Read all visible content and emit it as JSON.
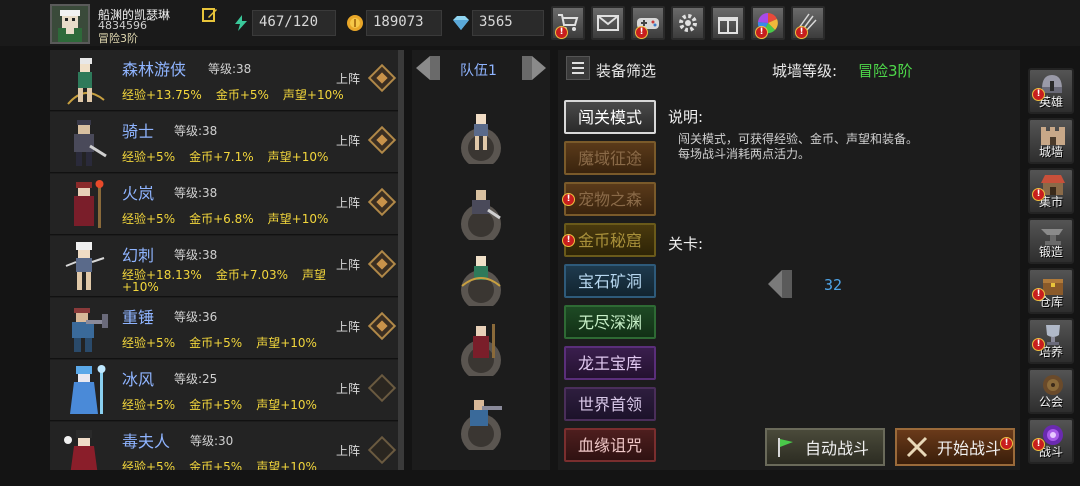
{
  "player": {
    "name": "船渊的凯瑟琳",
    "id": "4834596",
    "rank": "冒险3阶"
  },
  "resources": [
    {
      "icon": "energy-icon",
      "value": "467/120"
    },
    {
      "icon": "gold-coin-icon",
      "value": "189073"
    },
    {
      "icon": "diamond-icon",
      "value": "3565"
    }
  ],
  "toolbar": [
    {
      "icon": "shop-cart-icon",
      "alert": true
    },
    {
      "icon": "mail-icon",
      "alert": false
    },
    {
      "icon": "gamepad-icon",
      "alert": true
    },
    {
      "icon": "settings-gear-icon",
      "alert": false
    },
    {
      "icon": "gift-icon",
      "alert": false
    },
    {
      "icon": "color-wheel-icon",
      "alert": true
    },
    {
      "icon": "fireworks-icon",
      "alert": true
    }
  ],
  "heroes": [
    {
      "name": "森林游侠",
      "level": "等级:38",
      "stats": [
        "经验+13.75%",
        "金币+5%",
        "声望+10%"
      ],
      "action": "上阵",
      "deployed": true
    },
    {
      "name": "骑士",
      "level": "等级:38",
      "stats": [
        "经验+5%",
        "金币+7.1%",
        "声望+10%"
      ],
      "action": "上阵",
      "deployed": true
    },
    {
      "name": "火岚",
      "level": "等级:38",
      "stats": [
        "经验+5%",
        "金币+6.8%",
        "声望+10%"
      ],
      "action": "上阵",
      "deployed": true
    },
    {
      "name": "幻刺",
      "level": "等级:38",
      "stats": [
        "经验+18.13%",
        "金币+7.03%",
        "声望"
      ],
      "stats_extra": "+10%",
      "action": "上阵",
      "deployed": true
    },
    {
      "name": "重锤",
      "level": "等级:36",
      "stats": [
        "经验+5%",
        "金币+5%",
        "声望+10%"
      ],
      "action": "上阵",
      "deployed": true
    },
    {
      "name": "冰风",
      "level": "等级:25",
      "stats": [
        "经验+5%",
        "金币+5%",
        "声望+10%"
      ],
      "action": "上阵",
      "deployed": false
    },
    {
      "name": "毒夫人",
      "level": "等级:30",
      "stats": [
        "经验+5%",
        "金币+5%",
        "声望+10%"
      ],
      "action": "上阵",
      "deployed": false
    }
  ],
  "team": {
    "title": "队伍1"
  },
  "filter": {
    "label": "装备筛选",
    "wall_label": "城墙等级:",
    "wall_value": "冒险3阶"
  },
  "modes": [
    {
      "label": "闯关模式",
      "alert": false,
      "selected": true
    },
    {
      "label": "魔域征途",
      "alert": false,
      "selected": false
    },
    {
      "label": "宠物之森",
      "alert": true,
      "selected": false
    },
    {
      "label": "金币秘窟",
      "alert": true,
      "selected": false
    },
    {
      "label": "宝石矿洞",
      "alert": false,
      "selected": false
    },
    {
      "label": "无尽深渊",
      "alert": false,
      "selected": false
    },
    {
      "label": "龙王宝库",
      "alert": false,
      "selected": false
    },
    {
      "label": "世界首领",
      "alert": false,
      "selected": false
    },
    {
      "label": "血缘诅咒",
      "alert": false,
      "selected": false
    }
  ],
  "description": {
    "title": "说明:",
    "line1": "闯关模式，可获得经验、金币、声望和装备。",
    "line2": "每场战斗消耗两点活力。"
  },
  "stage": {
    "title": "关卡:",
    "value": "32"
  },
  "actions": {
    "auto_battle": "自动战斗",
    "start_battle": "开始战斗"
  },
  "sidebar": [
    {
      "label": "英雄",
      "icon": "helmet-icon",
      "alert": true
    },
    {
      "label": "城墙",
      "icon": "castle-wall-icon",
      "alert": false
    },
    {
      "label": "集市",
      "icon": "market-icon",
      "alert": true
    },
    {
      "label": "锻造",
      "icon": "anvil-icon",
      "alert": false
    },
    {
      "label": "仓库",
      "icon": "warehouse-icon",
      "alert": true
    },
    {
      "label": "培养",
      "icon": "trophy-icon",
      "alert": true
    },
    {
      "label": "公会",
      "icon": "guild-icon",
      "alert": false
    },
    {
      "label": "战斗",
      "icon": "battle-portal-icon",
      "alert": true
    }
  ]
}
